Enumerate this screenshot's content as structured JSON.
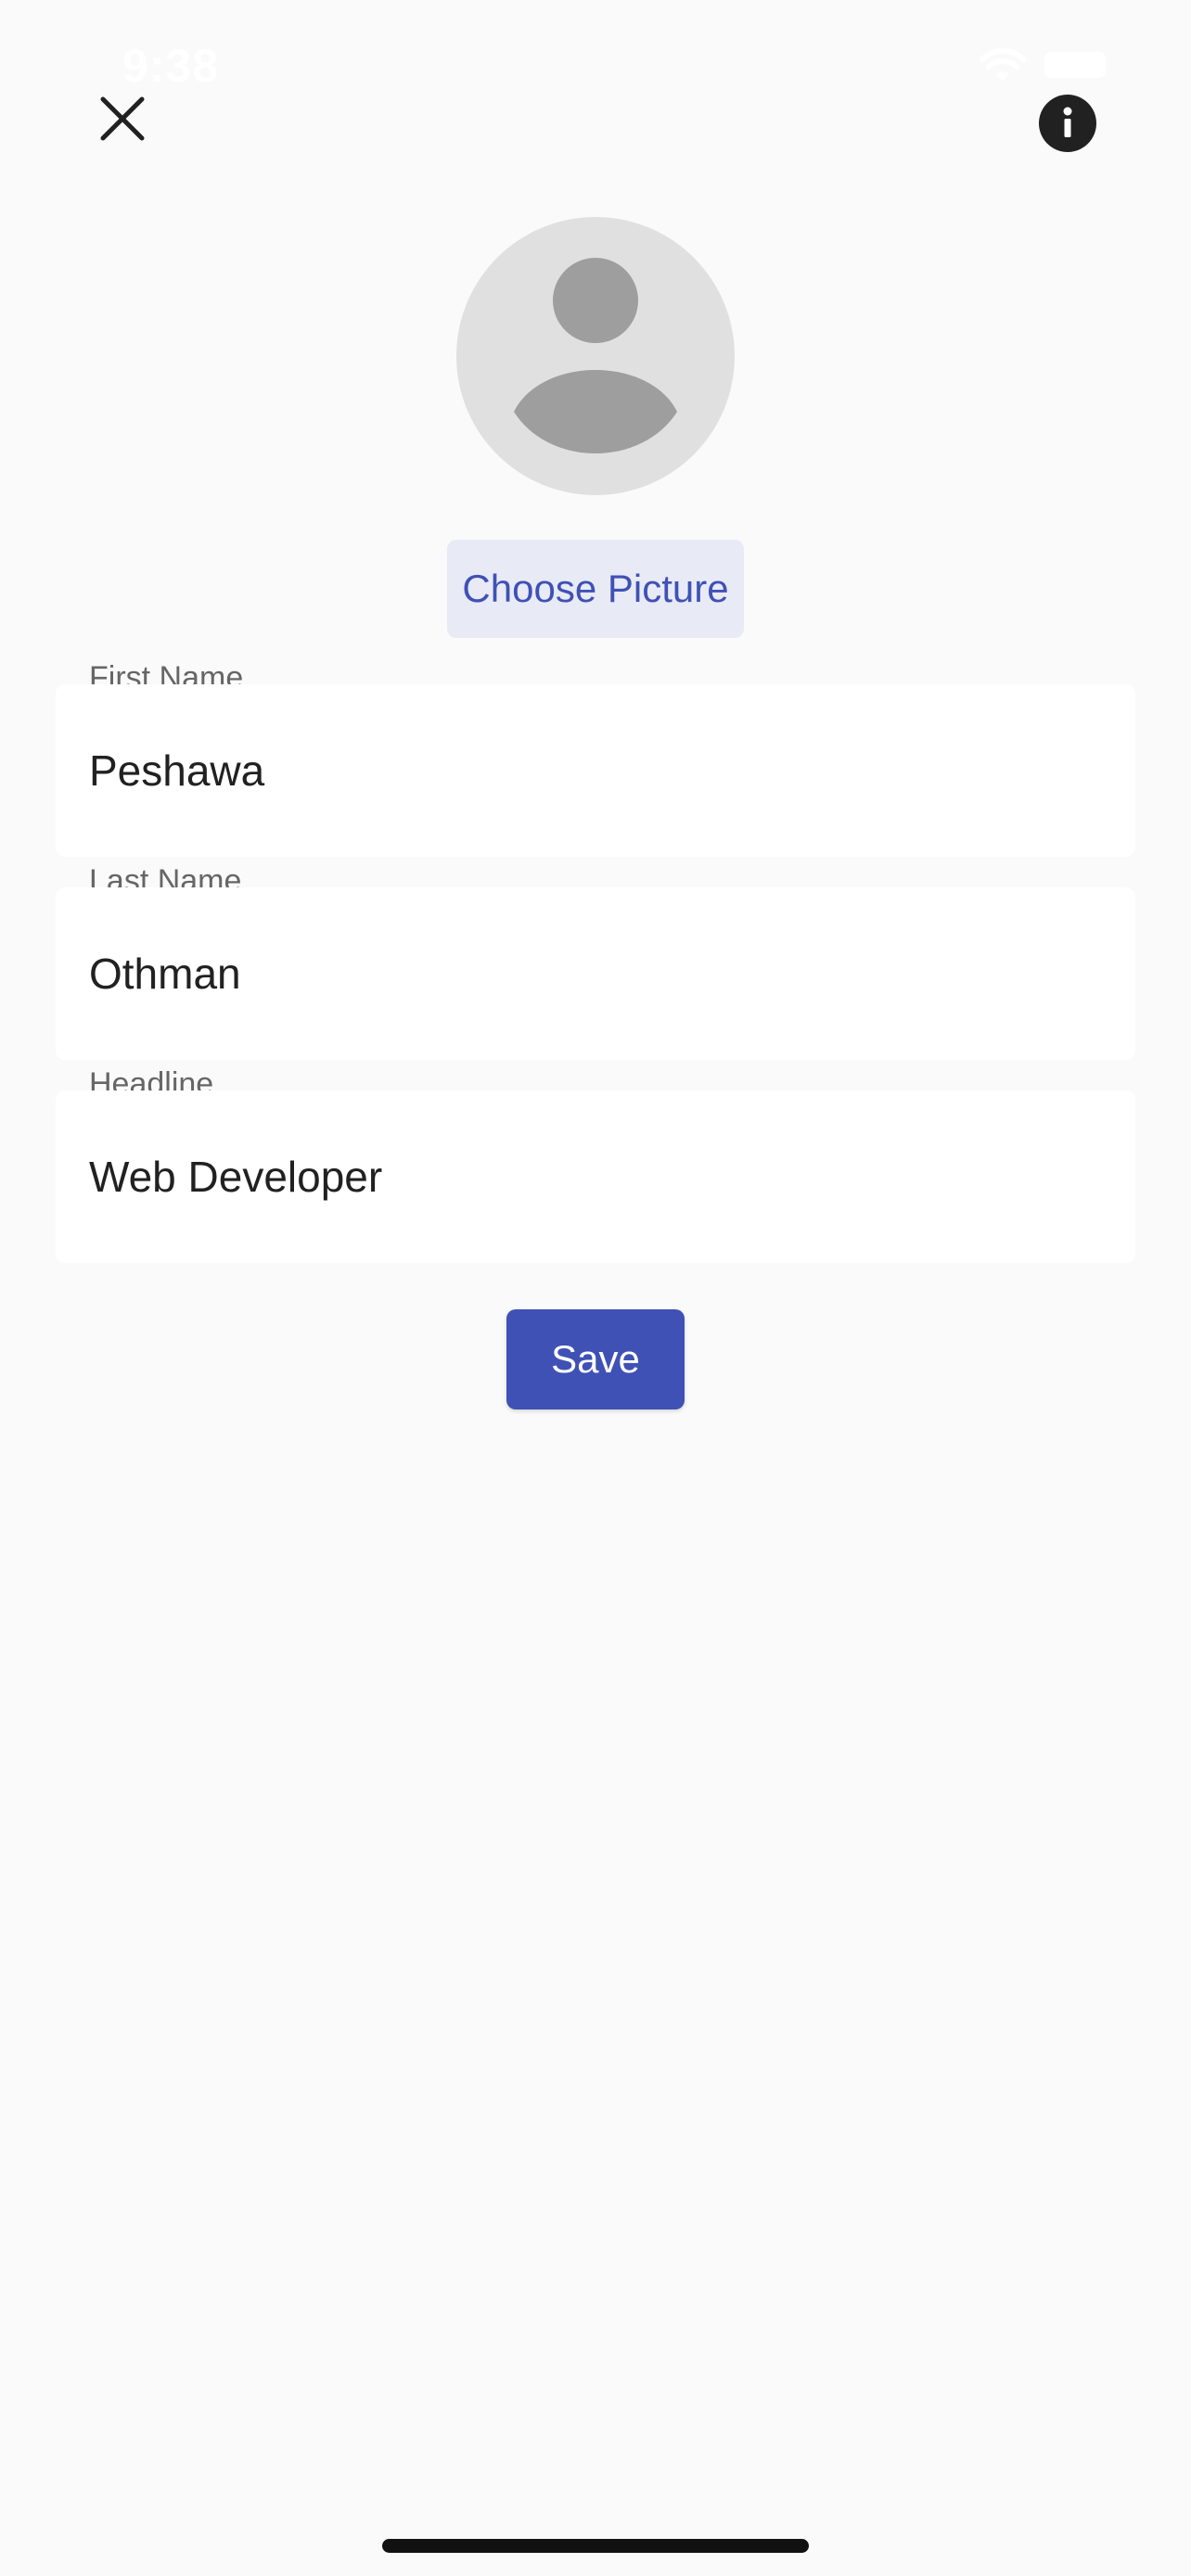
{
  "status_bar": {
    "time": "9:38",
    "wifi_icon": "wifi-icon",
    "battery_icon": "battery-icon"
  },
  "header": {
    "close_icon": "close-icon",
    "info_icon": "info-icon"
  },
  "profile": {
    "avatar_icon": "person-placeholder-icon",
    "choose_picture_label": "Choose Picture"
  },
  "form": {
    "first_name": {
      "label": "First Name",
      "value": "Peshawa"
    },
    "last_name": {
      "label": "Last Name",
      "value": "Othman"
    },
    "headline": {
      "label": "Headline",
      "value": "Web Developer"
    }
  },
  "actions": {
    "save_label": "Save"
  },
  "colors": {
    "background": "#fafafa",
    "primary": "#3f51b5",
    "primary_light": "#e8eaf6",
    "avatar_bg": "#e0e0e0",
    "avatar_fg": "#9e9e9e",
    "input_bg": "#ffffff",
    "label_text": "#666666",
    "value_text": "#212121"
  }
}
